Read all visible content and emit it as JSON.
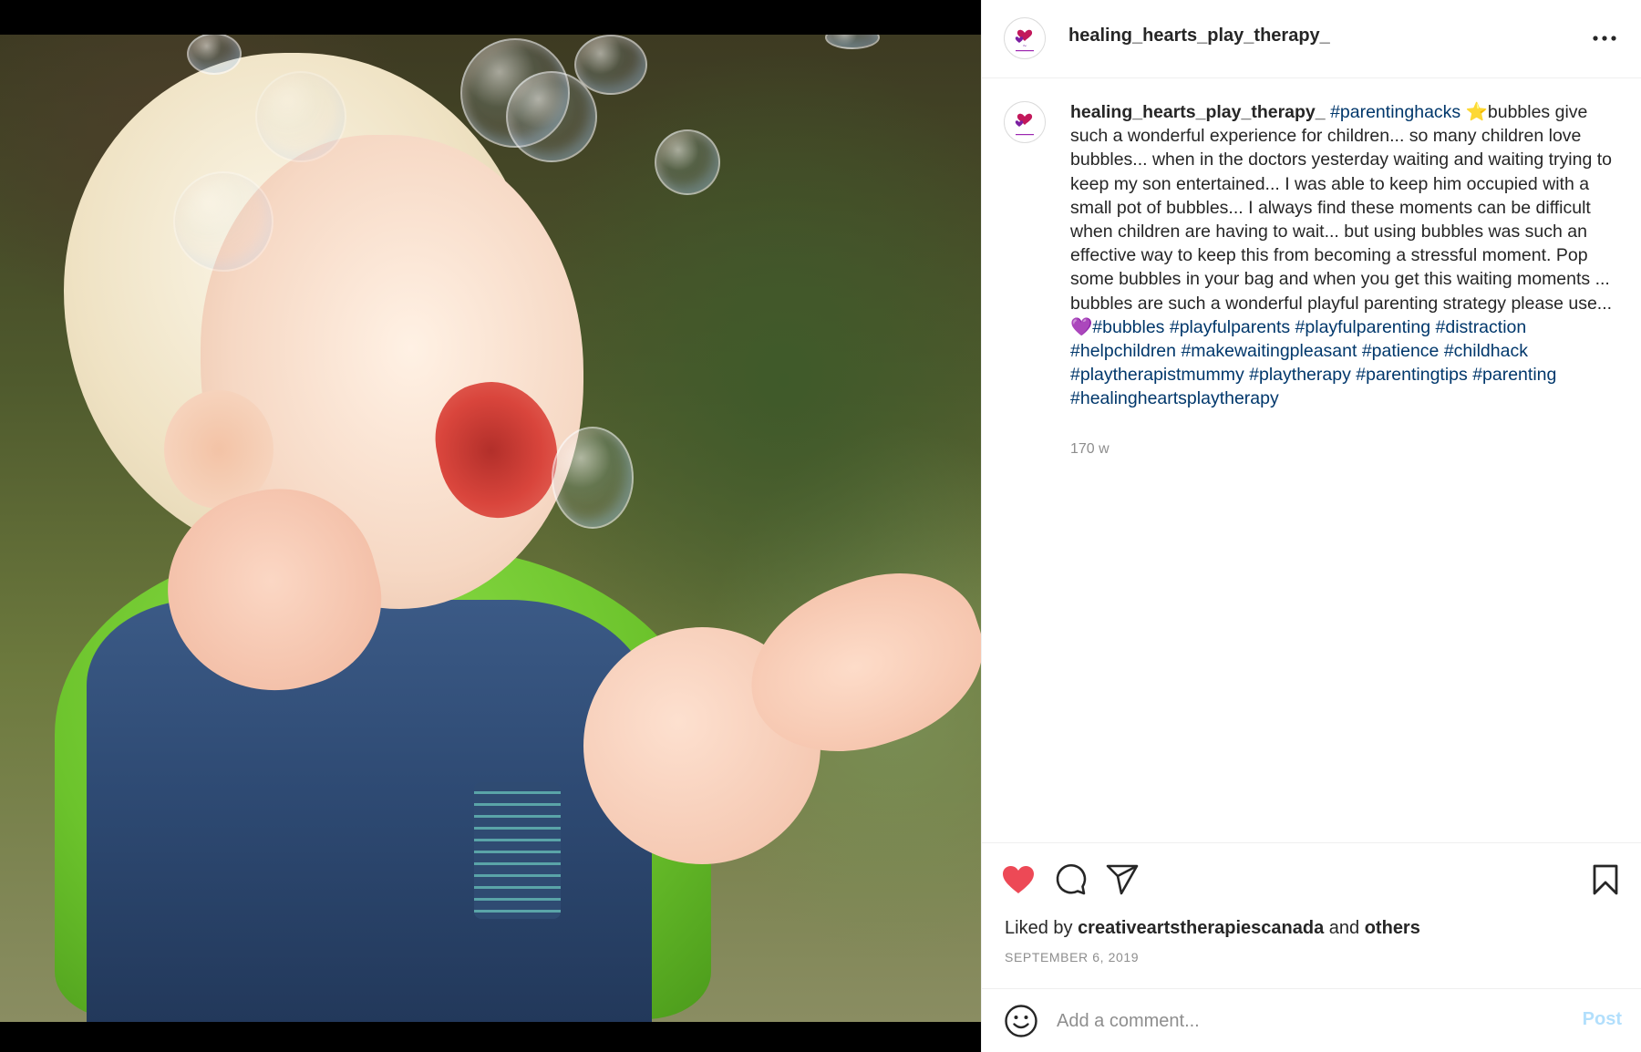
{
  "post": {
    "media": {
      "description_icon": "photo-child-bubbles"
    },
    "header": {
      "username": "healing_hearts_play_therapy_",
      "avatar_icon": "healing-hearts-logo",
      "more_icon": "more-options-icon"
    },
    "caption": {
      "username": "healing_hearts_play_therapy_",
      "hashtag_first": "#parentinghacks",
      "star_emoji": "⭐",
      "body": "bubbles give such a wonderful experience for children... so many children love bubbles... when in the doctors yesterday waiting and waiting trying to keep my son entertained... I was able to keep him occupied with a small pot of bubbles... I always find these moments can be difficult when children are having to wait... but using bubbles was such an effective way to keep this from becoming a stressful moment. Pop some bubbles in your bag and when you get this waiting moments ... bubbles are such a wonderful playful parenting strategy please use...",
      "heart_emoji": "💜",
      "hashtags": [
        "#bubbles",
        "#playfulparents",
        "#playfulparenting",
        "#distraction",
        "#helpchildren",
        "#makewaitingpleasant",
        "#patience",
        "#childhack",
        "#playtherapistmummy",
        "#playtherapy",
        "#parentingtips",
        "#parenting",
        "#healingheartsplaytherapy"
      ],
      "time_ago": "170 w"
    },
    "actions": {
      "like_icon": "heart-filled-icon",
      "comment_icon": "comment-icon",
      "share_icon": "share-icon",
      "save_icon": "bookmark-icon",
      "like_color": "#ed4956"
    },
    "likes": {
      "prefix": "Liked by",
      "user": "creativeartstherapiescanada",
      "middle": "and",
      "others": "others"
    },
    "date": "SEPTEMBER 6, 2019",
    "comment_box": {
      "placeholder": "Add a comment...",
      "post_label": "Post",
      "post_color": "#b2dffc",
      "emoji_icon": "smiley-icon"
    }
  }
}
